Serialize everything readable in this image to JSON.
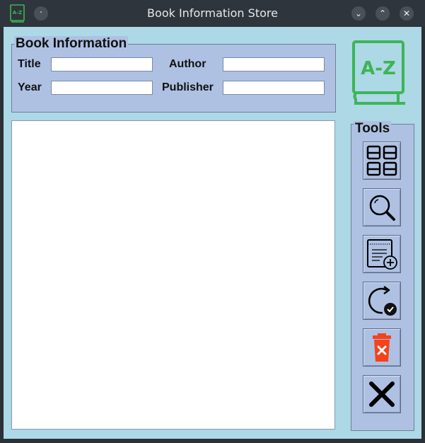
{
  "window": {
    "title": "Book Information Store",
    "logo_text": "A-Z",
    "menu_glyph": "·",
    "minimize_glyph": "⌄",
    "maximize_glyph": "⌃",
    "close_glyph": "✕"
  },
  "book_info": {
    "legend": "Book Information",
    "title_label": "Title",
    "author_label": "Author",
    "year_label": "Year",
    "publisher_label": "Publisher",
    "title_value": "",
    "author_value": "",
    "year_value": "",
    "publisher_value": ""
  },
  "results": {
    "items": []
  },
  "tools": {
    "legend": "Tools",
    "buttons": [
      {
        "icon": "grid-icon"
      },
      {
        "icon": "search-icon"
      },
      {
        "icon": "add-entry-icon"
      },
      {
        "icon": "update-icon"
      },
      {
        "icon": "trash-icon"
      },
      {
        "icon": "close-icon"
      }
    ]
  },
  "colors": {
    "background": "#add8e6",
    "panel": "#aec1e3",
    "logo_green": "#3cb556",
    "trash_red": "#f5421b"
  }
}
